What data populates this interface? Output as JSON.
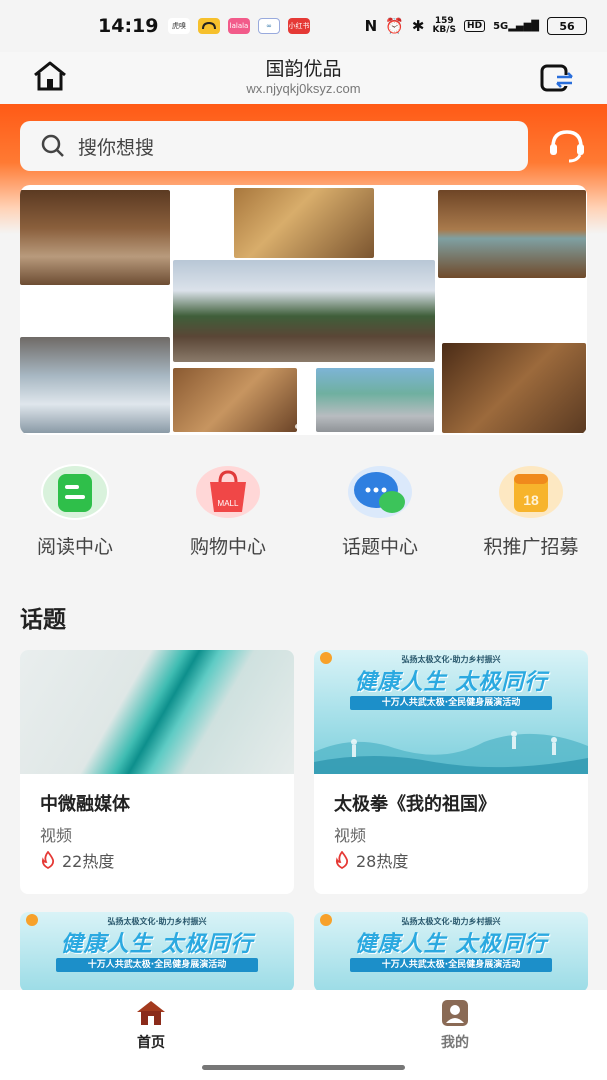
{
  "status_bar": {
    "time": "14:19",
    "apps": [
      "虎嗅",
      "",
      "lalala",
      "",
      "小红书"
    ],
    "speed_value": "159",
    "speed_unit": "KB/S",
    "hd": "HD",
    "network": "5G",
    "battery": "56"
  },
  "header": {
    "title": "国韵优品",
    "url": "wx.njyqkj0ksyz.com"
  },
  "search": {
    "placeholder": "搜你想搜"
  },
  "quick_nav": [
    {
      "label": "阅读中心",
      "icon": "book-icon"
    },
    {
      "label": "购物中心",
      "icon": "shopping-bag-icon"
    },
    {
      "label": "话题中心",
      "icon": "chat-bubbles-icon"
    },
    {
      "label": "积推广招募",
      "icon": "calendar-icon"
    }
  ],
  "topics": {
    "section_title": "话题",
    "poster_heading": "弘扬太极文化·助力乡村振兴",
    "poster_main": "健康人生  太极同行",
    "poster_sub": "十万人共武太极·全民健身展演活动",
    "cards": [
      {
        "title": "中微融媒体",
        "type": "视频",
        "heat": "22热度"
      },
      {
        "title": "太极拳《我的祖国》",
        "type": "视频",
        "heat": "28热度"
      }
    ]
  },
  "tab_bar": {
    "tabs": [
      {
        "label": "首页",
        "active": true
      },
      {
        "label": "我的",
        "active": false
      }
    ]
  },
  "colors": {
    "accent": "#ff5a16",
    "tab_active": "#8b2b1a",
    "tab_inactive": "#8a6a55"
  }
}
